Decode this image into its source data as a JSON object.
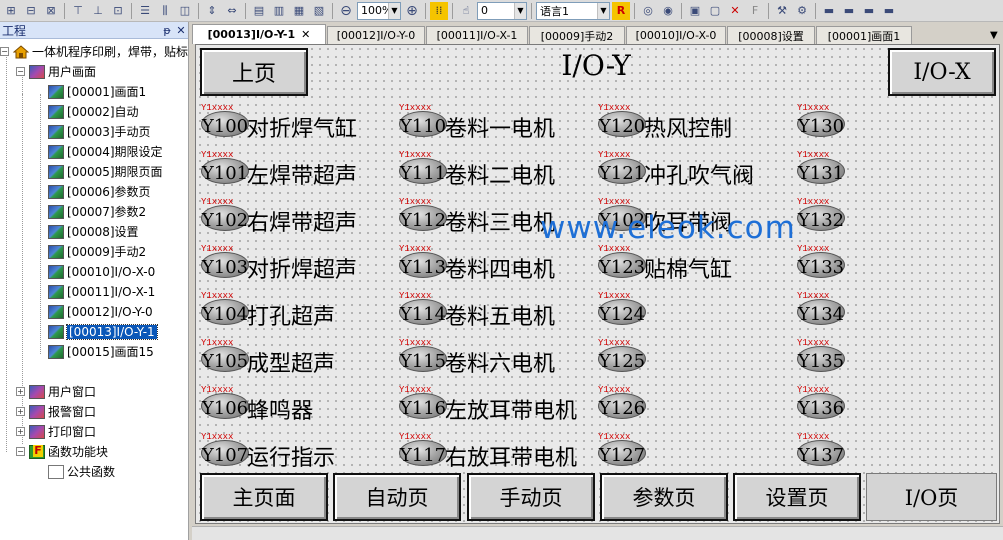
{
  "toolbar": {
    "zoom_value": "100%",
    "number_value": "0",
    "language_value": "语言1"
  },
  "tree": {
    "panel_title": "工程",
    "pin_glyph": "ᵽ",
    "close_glyph": "✕",
    "root_label": "一体机程序印刷，焊带，贴标",
    "user_screens_label": "用户画面",
    "screens": [
      {
        "label": "[00001]画面1"
      },
      {
        "label": "[00002]自动"
      },
      {
        "label": "[00003]手动页"
      },
      {
        "label": "[00004]期限设定"
      },
      {
        "label": "[00005]期限页面"
      },
      {
        "label": "[00006]参数页"
      },
      {
        "label": "[00007]参数2"
      },
      {
        "label": "[00008]设置"
      },
      {
        "label": "[00009]手动2"
      },
      {
        "label": "[00010]I/O-X-0"
      },
      {
        "label": "[00011]I/O-X-1"
      },
      {
        "label": "[00012]I/O-Y-0"
      },
      {
        "label": "[00013]I/O-Y-1"
      },
      {
        "label": "[00015]画面15"
      }
    ],
    "user_window_label": "用户窗口",
    "alarm_window_label": "报警窗口",
    "print_window_label": "打印窗口",
    "func_block_label": "函数功能块",
    "public_func_label": "公共函数"
  },
  "tabs": [
    {
      "label": "[00013]I/O-Y-1",
      "active": true,
      "close": "✕"
    },
    {
      "label": "[00012]I/O-Y-0"
    },
    {
      "label": "[00011]I/O-X-1"
    },
    {
      "label": "[00009]手动2"
    },
    {
      "label": "[00010]I/O-X-0"
    },
    {
      "label": "[00008]设置"
    },
    {
      "label": "[00001]画面1"
    }
  ],
  "tab_dropdown": "▼",
  "screen": {
    "prev_button": "上页",
    "title": "I/O-Y",
    "io_x_button": "I/O-X",
    "addr_text": "Y1xxxx",
    "columns": [
      [
        {
          "code": "Y100",
          "label": "对折焊气缸"
        },
        {
          "code": "Y101",
          "label": "左焊带超声"
        },
        {
          "code": "Y102",
          "label": "右焊带超声"
        },
        {
          "code": "Y103",
          "label": "对折焊超声"
        },
        {
          "code": "Y104",
          "label": "打孔超声"
        },
        {
          "code": "Y105",
          "label": "成型超声"
        },
        {
          "code": "Y106",
          "label": "蜂鸣器"
        },
        {
          "code": "Y107",
          "label": "运行指示"
        }
      ],
      [
        {
          "code": "Y110",
          "label": "卷料一电机"
        },
        {
          "code": "Y111",
          "label": "卷料二电机"
        },
        {
          "code": "Y112",
          "label": "卷料三电机"
        },
        {
          "code": "Y113",
          "label": "卷料四电机"
        },
        {
          "code": "Y114",
          "label": "卷料五电机"
        },
        {
          "code": "Y115",
          "label": "卷料六电机"
        },
        {
          "code": "Y116",
          "label": "左放耳带电机"
        },
        {
          "code": "Y117",
          "label": "右放耳带电机"
        }
      ],
      [
        {
          "code": "Y120",
          "label": "热风控制"
        },
        {
          "code": "Y121",
          "label": "冲孔吹气阀"
        },
        {
          "code": "Y102",
          "label": "吹耳带阀"
        },
        {
          "code": "Y123",
          "label": "贴棉气缸"
        },
        {
          "code": "Y124",
          "label": ""
        },
        {
          "code": "Y125",
          "label": ""
        },
        {
          "code": "Y126",
          "label": ""
        },
        {
          "code": "Y127",
          "label": ""
        }
      ],
      [
        {
          "code": "Y130",
          "label": ""
        },
        {
          "code": "Y131",
          "label": ""
        },
        {
          "code": "Y132",
          "label": ""
        },
        {
          "code": "Y133",
          "label": ""
        },
        {
          "code": "Y134",
          "label": ""
        },
        {
          "code": "Y135",
          "label": ""
        },
        {
          "code": "Y136",
          "label": ""
        },
        {
          "code": "Y137",
          "label": ""
        }
      ]
    ],
    "bottom_buttons": [
      {
        "label": "主页面"
      },
      {
        "label": "自动页"
      },
      {
        "label": "手动页"
      },
      {
        "label": "参数页"
      },
      {
        "label": "设置页"
      },
      {
        "label": "I/O页",
        "active": true
      }
    ]
  },
  "watermark": "www.eleok.com"
}
